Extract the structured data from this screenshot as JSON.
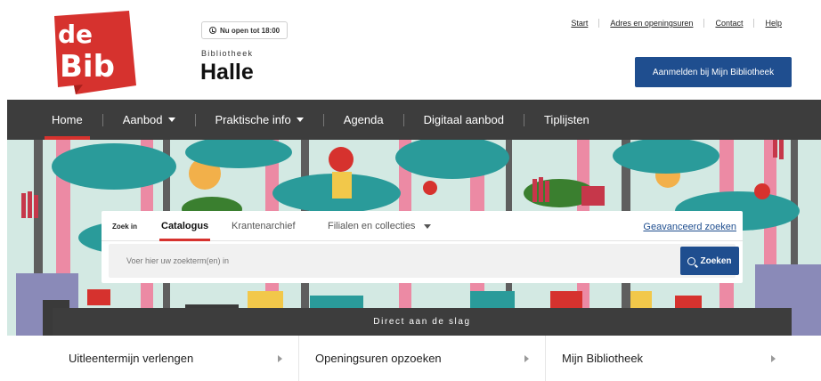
{
  "brand": {
    "logo_line1": "de",
    "logo_line2": "Bib",
    "logo_color": "#d6322e"
  },
  "header": {
    "open_status": "Nu open tot 18:00",
    "library_label": "Bibliotheek",
    "library_name": "Halle",
    "top_links": [
      "Start",
      "Adres en openingsuren",
      "Contact",
      "Help"
    ],
    "login_button": "Aanmelden bij Mijn Bibliotheek"
  },
  "nav": {
    "items": [
      {
        "label": "Home"
      },
      {
        "label": "Aanbod"
      },
      {
        "label": "Praktische info"
      },
      {
        "label": "Agenda"
      },
      {
        "label": "Digitaal aanbod"
      },
      {
        "label": "Tiplijsten"
      }
    ]
  },
  "search": {
    "label": "Zoek in",
    "tabs": [
      {
        "label": "Catalogus"
      },
      {
        "label": "Krantenarchief"
      },
      {
        "label": "Filialen en collecties"
      }
    ],
    "advanced_link": "Geavanceerd zoeken",
    "placeholder": "Voer hier uw zoekterm(en) in",
    "button": "Zoeken"
  },
  "quick": {
    "title": "Direct aan de slag",
    "items": [
      {
        "label": "Uitleentermijn verlengen"
      },
      {
        "label": "Openingsuren opzoeken"
      },
      {
        "label": "Mijn Bibliotheek"
      }
    ]
  },
  "colors": {
    "accent": "#d6322e",
    "primary": "#1f4e8f",
    "nav_bg": "#3d3d3d"
  }
}
